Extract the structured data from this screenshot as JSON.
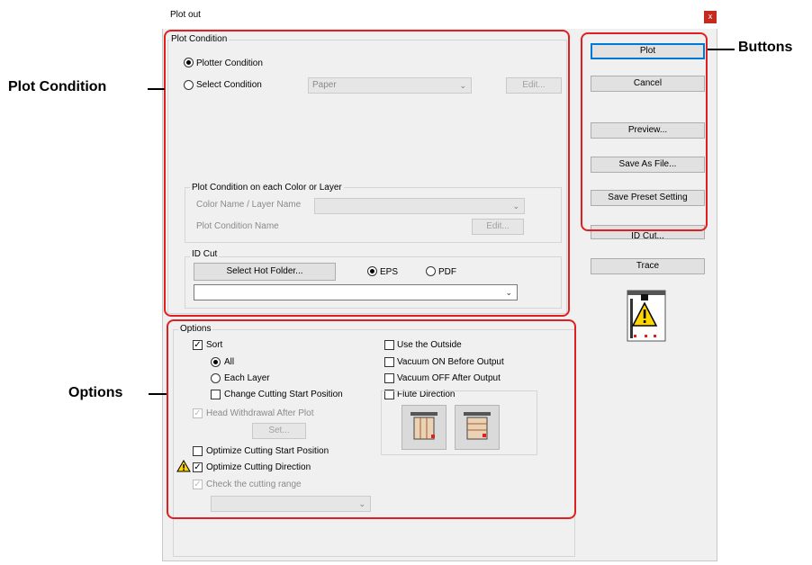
{
  "window": {
    "title": "Plot out",
    "close_glyph": "x"
  },
  "plot_condition": {
    "group_label": "Plot Condition",
    "plotter_condition": "Plotter Condition",
    "select_condition": "Select Condition",
    "condition_value": "Paper",
    "edit_label": "Edit...",
    "per_color": {
      "group_label": "Plot Condition on each Color or Layer",
      "color_name_label": "Color Name / Layer Name",
      "plot_condition_name_label": "Plot Condition Name",
      "edit_label": "Edit..."
    },
    "id_cut": {
      "group_label": "ID Cut",
      "select_folder_label": "Select Hot Folder...",
      "eps_label": "EPS",
      "pdf_label": "PDF"
    }
  },
  "options": {
    "group_label": "Options",
    "sort": "Sort",
    "all": "All",
    "each_layer": "Each Layer",
    "change_cutting_start": "Change Cutting Start Position",
    "head_withdrawal": "Head Withdrawal After Plot",
    "set_label": "Set...",
    "optimize_start": "Optimize Cutting Start Position",
    "optimize_direction": "Optimize Cutting Direction",
    "check_range": "Check the cutting range",
    "use_outside": "Use the Outside",
    "vacuum_on": "Vacuum ON Before Output",
    "vacuum_off": "Vacuum OFF After Output",
    "flute_direction": "Flute Direction",
    "check_glyph": "✓"
  },
  "buttons": {
    "plot": "Plot",
    "cancel": "Cancel",
    "preview": "Preview...",
    "save_as_file": "Save As File...",
    "save_preset": "Save Preset Setting",
    "id_cut": "ID Cut...",
    "trace": "Trace"
  },
  "callouts": {
    "plot_condition": "Plot Condition",
    "options": "Options",
    "buttons": "Buttons"
  },
  "colors": {
    "highlight": "#e02020",
    "accent": "#0078d7",
    "warning": "#ffd500"
  },
  "icons": [
    "warning-icon",
    "flute-vertical-icon",
    "flute-horizontal-icon",
    "chevron-down-icon"
  ]
}
